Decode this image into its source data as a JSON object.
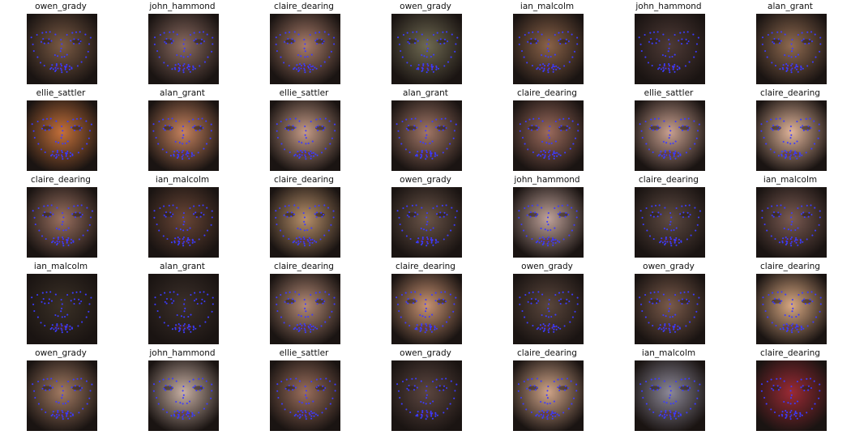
{
  "rows": [
    [
      {
        "name": "owen_grady",
        "tone": "#7a5a44"
      },
      {
        "name": "john_hammond",
        "tone": "#8a6a60"
      },
      {
        "name": "claire_dearing",
        "tone": "#a97c6a"
      },
      {
        "name": "owen_grady",
        "tone": "#6f6a52"
      },
      {
        "name": "ian_malcolm",
        "tone": "#8a6248"
      },
      {
        "name": "john_hammond",
        "tone": "#4e3a36"
      },
      {
        "name": "alan_grant",
        "tone": "#8f6a50"
      }
    ],
    [
      {
        "name": "ellie_sattler",
        "tone": "#c4703a"
      },
      {
        "name": "alan_grant",
        "tone": "#c6825e"
      },
      {
        "name": "ellie_sattler",
        "tone": "#c49a86"
      },
      {
        "name": "alan_grant",
        "tone": "#a17666"
      },
      {
        "name": "claire_dearing",
        "tone": "#9b6a5c"
      },
      {
        "name": "ellie_sattler",
        "tone": "#c9a090"
      },
      {
        "name": "claire_dearing",
        "tone": "#e0b49a"
      }
    ],
    [
      {
        "name": "claire_dearing",
        "tone": "#9a7060"
      },
      {
        "name": "ian_malcolm",
        "tone": "#6a4636"
      },
      {
        "name": "claire_dearing",
        "tone": "#b8906a"
      },
      {
        "name": "owen_grady",
        "tone": "#6a5448"
      },
      {
        "name": "john_hammond",
        "tone": "#c0a29a"
      },
      {
        "name": "claire_dearing",
        "tone": "#5e4a42"
      },
      {
        "name": "ian_malcolm",
        "tone": "#7a5a52"
      }
    ],
    [
      {
        "name": "ian_malcolm",
        "tone": "#3a3026"
      },
      {
        "name": "alan_grant",
        "tone": "#3c302a"
      },
      {
        "name": "claire_dearing",
        "tone": "#b48a76"
      },
      {
        "name": "claire_dearing",
        "tone": "#c89272"
      },
      {
        "name": "owen_grady",
        "tone": "#5a463c"
      },
      {
        "name": "owen_grady",
        "tone": "#7a5a4a"
      },
      {
        "name": "claire_dearing",
        "tone": "#d8a882"
      }
    ],
    [
      {
        "name": "owen_grady",
        "tone": "#a27a62"
      },
      {
        "name": "john_hammond",
        "tone": "#c8b0a4"
      },
      {
        "name": "ellie_sattler",
        "tone": "#9a6e5c"
      },
      {
        "name": "owen_grady",
        "tone": "#5c4640"
      },
      {
        "name": "claire_dearing",
        "tone": "#d0a488"
      },
      {
        "name": "ian_malcolm",
        "tone": "#8c8898"
      },
      {
        "name": "claire_dearing",
        "tone": "#9a2a34"
      }
    ]
  ],
  "colors": {
    "background": "#ffffff",
    "landmark": "#3b3bff",
    "label_text": "#111111"
  }
}
